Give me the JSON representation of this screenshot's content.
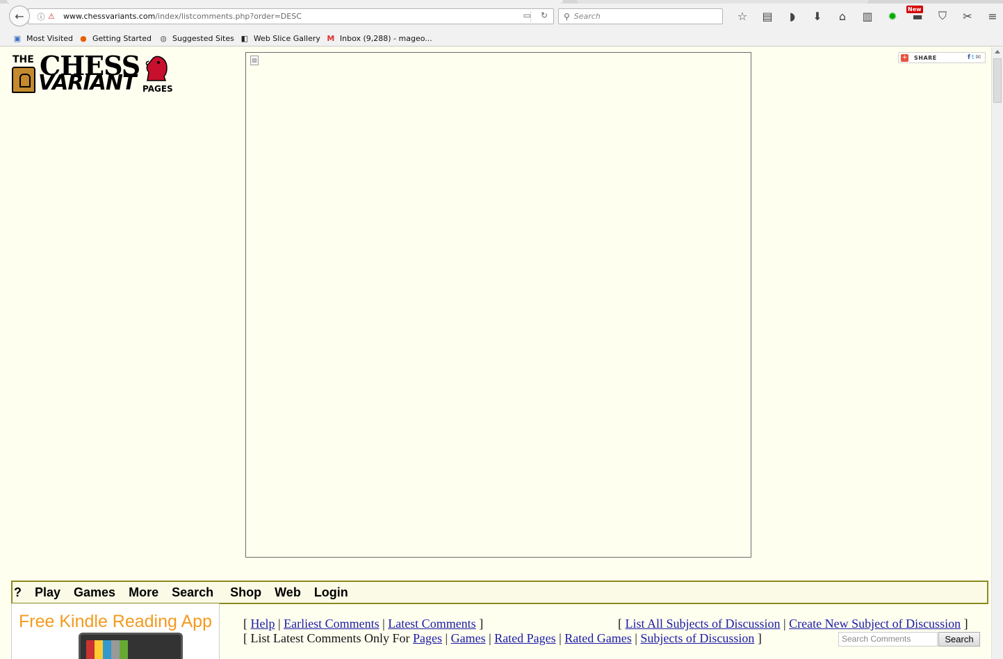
{
  "browser": {
    "url_domain": "www.chessvariants.com",
    "url_path": "/index/listcomments.php?order=DESC",
    "search_placeholder": "Search",
    "new_badge": "New",
    "bookmarks": [
      {
        "label": "Most Visited",
        "icon": "bookmark-folder-icon"
      },
      {
        "label": "Getting Started",
        "icon": "firefox-icon"
      },
      {
        "label": "Suggested Sites",
        "icon": "globe-icon"
      },
      {
        "label": "Web Slice Gallery",
        "icon": "web-slice-icon"
      },
      {
        "label": "Inbox (9,288) - mageo...",
        "icon": "gmail-icon"
      }
    ]
  },
  "logo": {
    "the": "THE",
    "chess": "CHESS",
    "variant": "VARIANT",
    "pages": "PAGES"
  },
  "share": {
    "label": "SHARE",
    "facebook": "f",
    "twitter": "t",
    "email": "✉"
  },
  "nav": {
    "items": [
      "?",
      "Play",
      "Games",
      "More",
      "Search",
      "Shop",
      "Web",
      "Login"
    ]
  },
  "ad": {
    "kindle_title": "Free Kindle Reading App"
  },
  "comments": {
    "row1_left": {
      "open": "[",
      "help": "Help",
      "sep1": "|",
      "earliest": "Earliest Comments",
      "sep2": "|",
      "latest": "Latest Comments",
      "close": "]"
    },
    "row1_right": {
      "open": "[",
      "list_all": "List All Subjects of Discussion",
      "sep1": "|",
      "create_new": "Create New Subject of Discussion",
      "close": "]"
    },
    "row2": {
      "prefix": "[ List Latest Comments Only For",
      "pages": "Pages",
      "sep1": "|",
      "games": "Games",
      "sep2": "|",
      "rated_pages": "Rated Pages",
      "sep3": "|",
      "rated_games": "Rated Games",
      "sep4": "|",
      "subjects": "Subjects of Discussion",
      "close": "]"
    },
    "search_placeholder": "Search Comments",
    "search_button": "Search"
  }
}
